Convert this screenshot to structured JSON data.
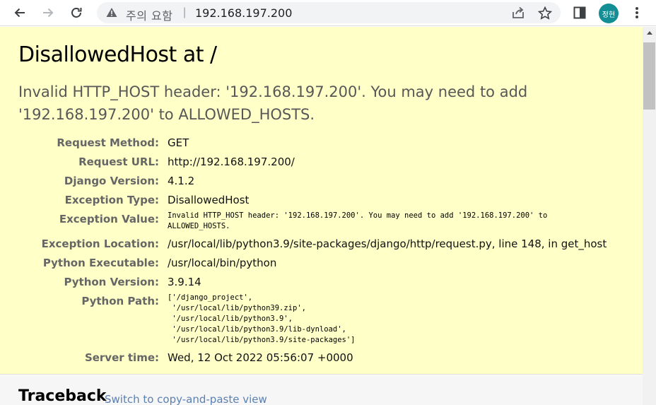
{
  "browser": {
    "security_warning": "주의 요함",
    "separator": "|",
    "url": "192.168.197.200",
    "profile_initials": "정현"
  },
  "error": {
    "title": "DisallowedHost at /",
    "exception_value_line1": "Invalid HTTP_HOST header: '192.168.197.200'. You may need to add",
    "exception_value_line2": "'192.168.197.200' to ALLOWED_HOSTS."
  },
  "meta": {
    "request_method": {
      "label": "Request Method:",
      "value": "GET"
    },
    "request_url": {
      "label": "Request URL:",
      "value": "http://192.168.197.200/"
    },
    "django_version": {
      "label": "Django Version:",
      "value": "4.1.2"
    },
    "exception_type": {
      "label": "Exception Type:",
      "value": "DisallowedHost"
    },
    "exception_value": {
      "label": "Exception Value:",
      "value": "Invalid HTTP_HOST header: '192.168.197.200'. You may need to add '192.168.197.200' to\nALLOWED_HOSTS."
    },
    "exception_location": {
      "label": "Exception Location:",
      "value": "/usr/local/lib/python3.9/site-packages/django/http/request.py, line 148, in get_host"
    },
    "python_executable": {
      "label": "Python Executable:",
      "value": "/usr/local/bin/python"
    },
    "python_version": {
      "label": "Python Version:",
      "value": "3.9.14"
    },
    "python_path": {
      "label": "Python Path:",
      "value": "['/django_project',\n '/usr/local/lib/python39.zip',\n '/usr/local/lib/python3.9',\n '/usr/local/lib/python3.9/lib-dynload',\n '/usr/local/lib/python3.9/site-packages']"
    },
    "server_time": {
      "label": "Server time:",
      "value": "Wed, 12 Oct 2022 05:56:07 +0000"
    }
  },
  "traceback": {
    "title": "Traceback",
    "switch_link": "Switch to copy-and-paste view"
  },
  "colors": {
    "summary_bg": "#ffffc8",
    "avatar_bg": "#138e94",
    "link": "#5b80b2"
  }
}
